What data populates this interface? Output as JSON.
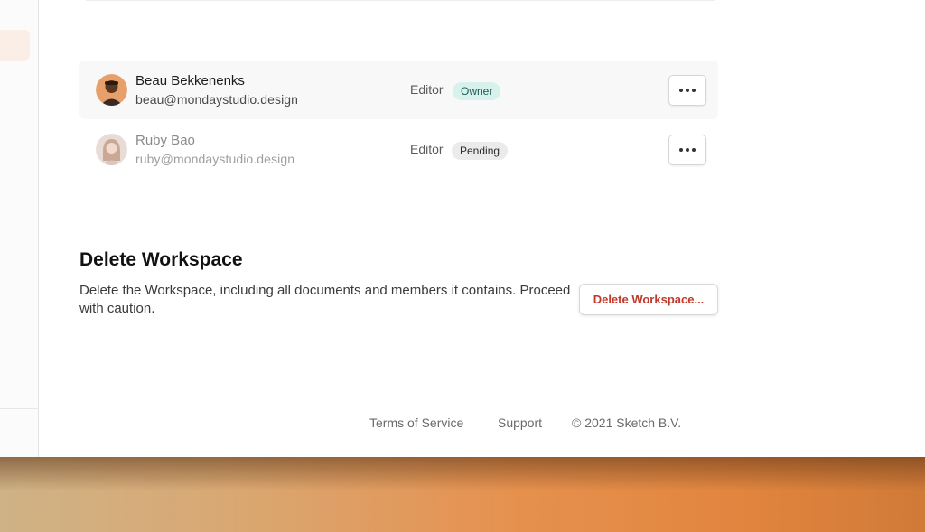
{
  "members": [
    {
      "name": "Beau Bekkenenks",
      "email": "beau@mondaystudio.design",
      "role": "Editor",
      "badge": "Owner",
      "avatar_icon": "user-photo-icon"
    },
    {
      "name": "Ruby Bao",
      "email": "ruby@mondaystudio.design",
      "role": "Editor",
      "badge": "Pending",
      "avatar_icon": "user-photo-icon"
    }
  ],
  "delete_section": {
    "title": "Delete Workspace",
    "description": "Delete the Workspace, including all documents and members it contains. Proceed with caution.",
    "button_label": "Delete Workspace..."
  },
  "footer": {
    "terms": "Terms of Service",
    "support": "Support",
    "copyright": "© 2021 Sketch B.V."
  },
  "colors": {
    "owner_badge_bg": "#d7f1ec",
    "pending_badge_bg": "#ebebeb",
    "danger": "#c0392b",
    "sidebar_active": "#fbeee6"
  }
}
